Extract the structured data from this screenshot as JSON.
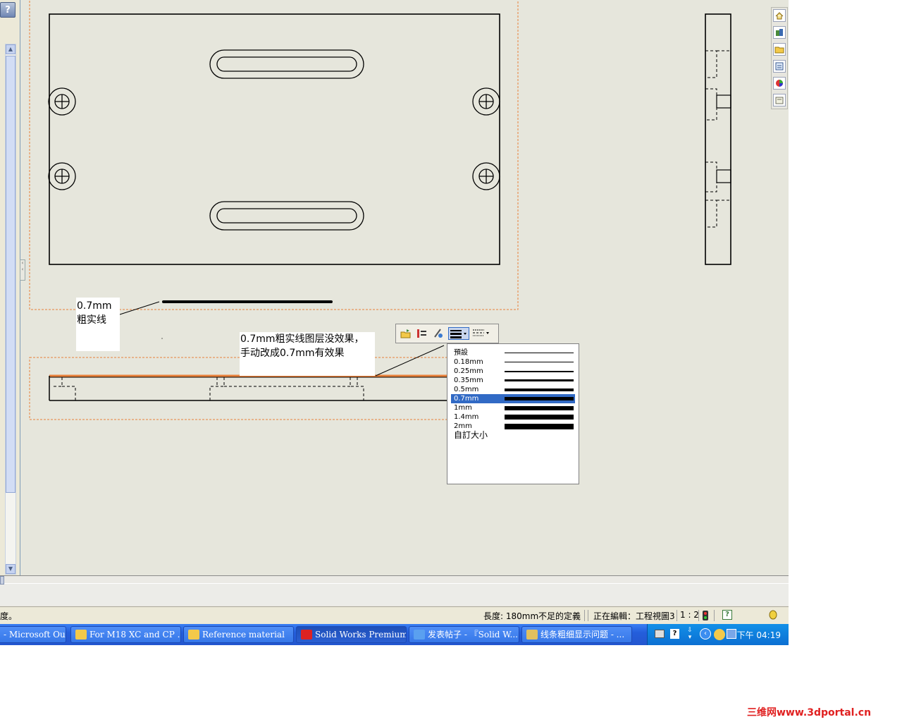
{
  "help": {
    "label": "?"
  },
  "annotations": {
    "left_note_line1": "0.7mm",
    "left_note_line2": "粗实线",
    "center_note_line1": "0.7mm粗实线图层没效果，",
    "center_note_line2": "手动改成0.7mm有效果"
  },
  "line_width_menu": {
    "items": [
      {
        "label": "預設",
        "thickness_px": 1
      },
      {
        "label": "0.18mm",
        "thickness_px": 1
      },
      {
        "label": "0.25mm",
        "thickness_px": 2
      },
      {
        "label": "0.35mm",
        "thickness_px": 3
      },
      {
        "label": "0.5mm",
        "thickness_px": 4
      },
      {
        "label": "0.7mm",
        "thickness_px": 5,
        "selected": true
      },
      {
        "label": "1mm",
        "thickness_px": 6
      },
      {
        "label": "1.4mm",
        "thickness_px": 7
      },
      {
        "label": "2mm",
        "thickness_px": 8
      }
    ],
    "custom_label": "自訂大小"
  },
  "statusbar": {
    "left_text": "度。",
    "length": "長度: 180mm",
    "definition": "不足的定義",
    "editing": "正在編輯：工程視圖3",
    "scale": "1 : 2"
  },
  "taskbar": {
    "tasks": [
      {
        "label": "- Microsoft Outl...",
        "icon": "outlook-icon"
      },
      {
        "label": "For M18 XC and CP ...",
        "icon": "folder-icon"
      },
      {
        "label": "Reference material",
        "icon": "folder-icon"
      },
      {
        "label": "Solid Works Premium ...",
        "icon": "solidworks-icon",
        "active": true
      },
      {
        "label": "发表帖子 - 『Solid W...",
        "icon": "ie-icon"
      },
      {
        "label": "线条粗细显示问题 - ...",
        "icon": "paint-icon"
      }
    ],
    "clock": "下午 04:19"
  },
  "watermark": "三维网www.3dportal.cn",
  "colors": {
    "canvas": "#e6e6dc",
    "sheet_border": "#e8803a",
    "menu_selected": "#316ac5",
    "taskbar": "#245edb"
  }
}
